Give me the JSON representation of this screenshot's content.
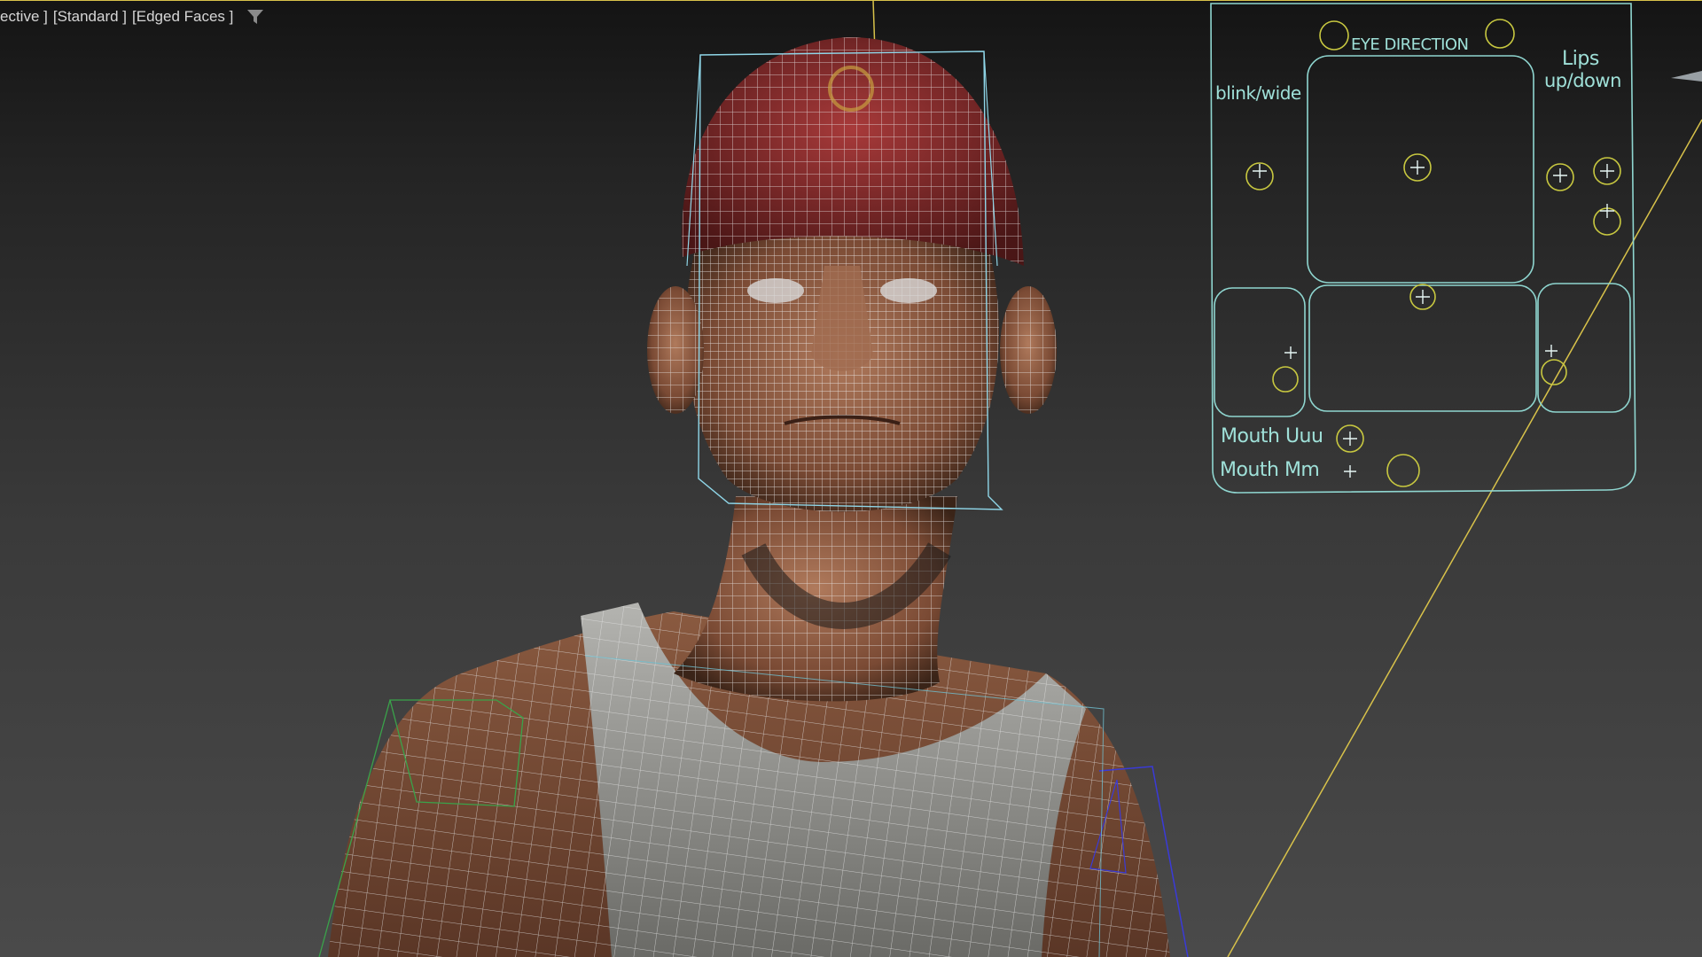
{
  "viewport": {
    "label_perspective": "ective ]",
    "label_shading": "[Standard ]",
    "label_mode": "[Edged Faces ]",
    "filter_icon": "filter-funnel-icon",
    "border_color": "#d8c24a"
  },
  "face_ui": {
    "eye_direction_label": "EYE DIRECTION",
    "blink_wide_label": "blink/wide",
    "lips_label_line1": "Lips",
    "lips_label_line2": "up/down",
    "mouth_uuu_label": "Mouth Uuu",
    "mouth_mm_label": "Mouth Mm",
    "panel_color": "#8fd6d0",
    "handle_color": "#c8c840"
  },
  "scene": {
    "object": "character-head-wireframe",
    "wire_color": "#e8e8e8",
    "skin_color": "#8a5a40",
    "cap_color": "#8a2a2a",
    "shirt_color": "#9a9a96"
  }
}
